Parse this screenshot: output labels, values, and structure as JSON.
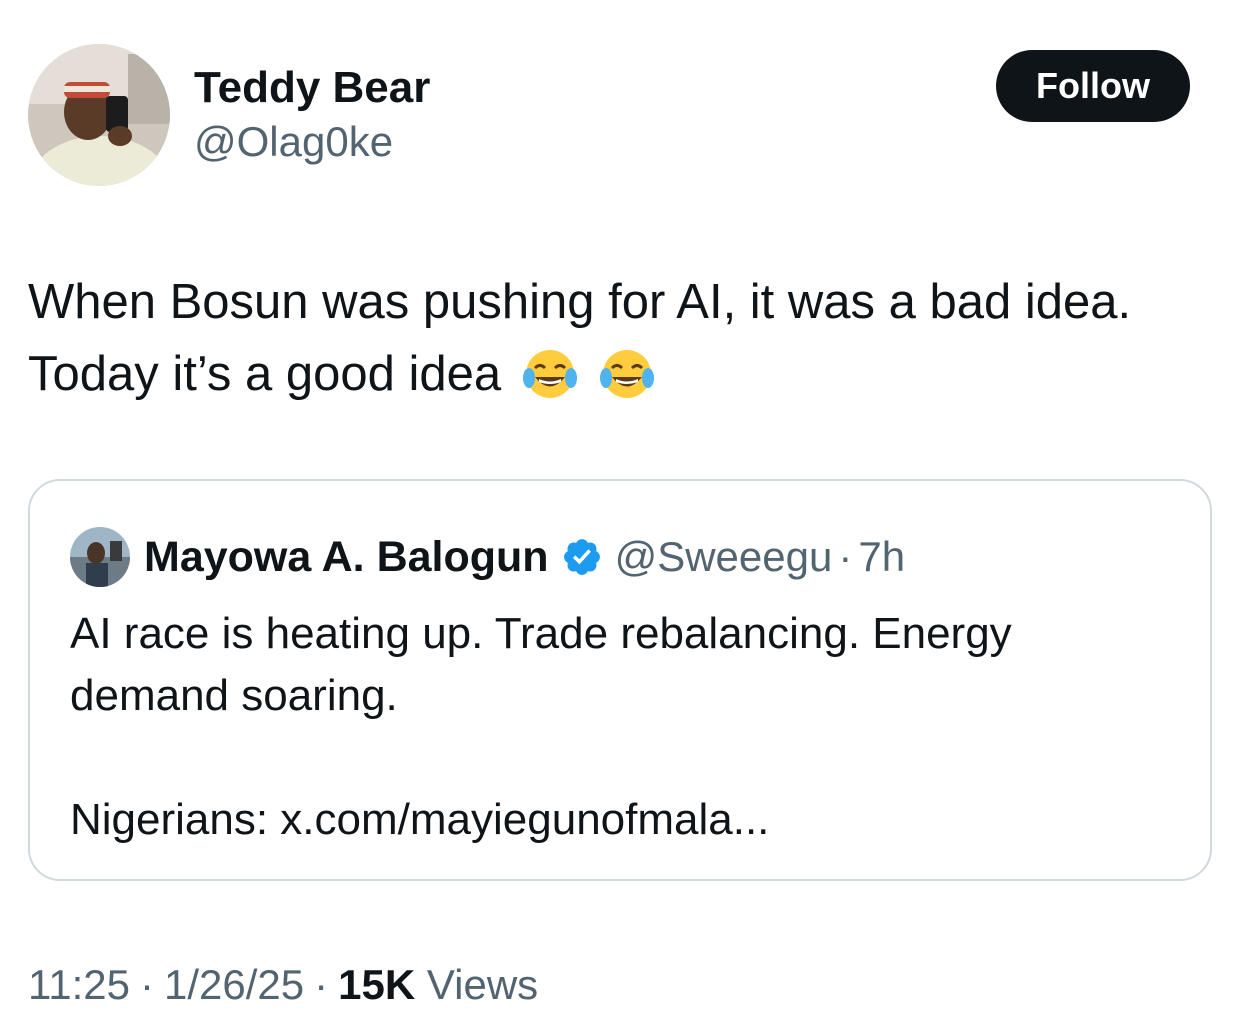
{
  "author": {
    "display_name": "Teddy Bear",
    "handle": "@Olag0ke"
  },
  "follow_label": "Follow",
  "tweet_text": "When Bosun was pushing for AI, it was a bad idea. Today it’s a good idea",
  "tweet_emojis": [
    "face-with-tears-of-joy-icon",
    "face-with-tears-of-joy-icon"
  ],
  "quoted": {
    "display_name": "Mayowa A. Balogun",
    "verified": true,
    "handle": "@Sweeegu",
    "separator": "·",
    "time": "7h",
    "line1": "AI race is heating up. Trade rebalancing. Energy",
    "line2": "demand soaring.",
    "line3": "Nigerians: x.com/mayiegunofmala..."
  },
  "meta": {
    "time": "11:25",
    "separator": "·",
    "date": "1/26/25",
    "views_count": "15K",
    "views_label": "Views"
  },
  "colors": {
    "text_primary": "#0f1419",
    "text_secondary": "#536471",
    "border": "#cfd9de",
    "verified_blue": "#1d9bf0",
    "button_bg": "#0f1419"
  }
}
